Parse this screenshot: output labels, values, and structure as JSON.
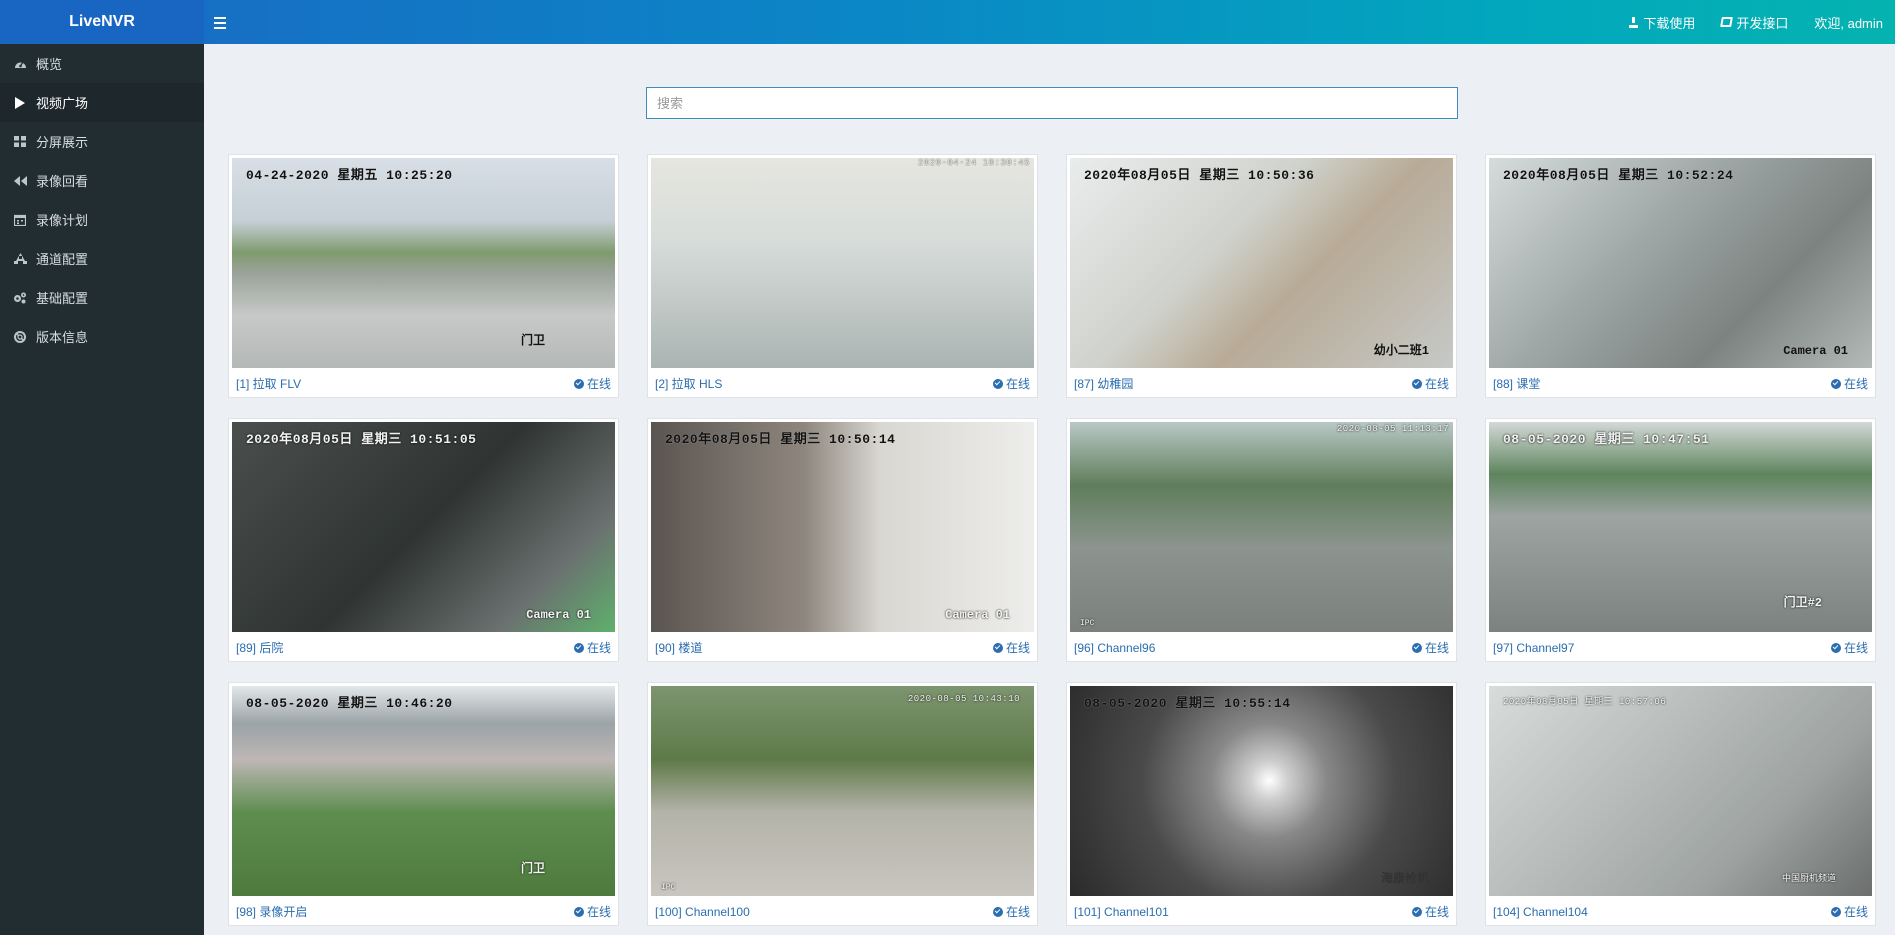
{
  "app": {
    "logo": "LiveNVR"
  },
  "topbar": {
    "download_label": "下载使用",
    "api_label": "开发接口",
    "welcome": "欢迎, admin"
  },
  "sidebar": {
    "items": [
      {
        "label": "概览",
        "icon": "dashboard-icon",
        "active": false
      },
      {
        "label": "视频广场",
        "icon": "play-icon",
        "active": true
      },
      {
        "label": "分屏展示",
        "icon": "grid-icon",
        "active": false
      },
      {
        "label": "录像回看",
        "icon": "backward-icon",
        "active": false
      },
      {
        "label": "录像计划",
        "icon": "calendar-icon",
        "active": false
      },
      {
        "label": "通道配置",
        "icon": "sitemap-icon",
        "active": false
      },
      {
        "label": "基础配置",
        "icon": "cogs-icon",
        "active": false
      },
      {
        "label": "版本信息",
        "icon": "lifebuoy-icon",
        "active": false
      }
    ]
  },
  "search": {
    "placeholder": "搜索",
    "value": ""
  },
  "channels": [
    {
      "label": "[1] 拉取 FLV",
      "status": "在线",
      "osd_time": "04-24-2020  星期五  10:25:20",
      "osd_cam": "门卫"
    },
    {
      "label": "[2] 拉取 HLS",
      "status": "在线",
      "osd_time": "2020-04-24 10:30:45",
      "osd_cam": ""
    },
    {
      "label": "[87] 幼稚园",
      "status": "在线",
      "osd_time": "2020年08月05日  星期三  10:50:36",
      "osd_cam": "幼小二班1"
    },
    {
      "label": "[88] 课堂",
      "status": "在线",
      "osd_time": "2020年08月05日  星期三  10:52:24",
      "osd_cam": "Camera 01"
    },
    {
      "label": "[89] 后院",
      "status": "在线",
      "osd_time": "2020年08月05日  星期三  10:51:05",
      "osd_cam": "Camera 01"
    },
    {
      "label": "[90] 楼道",
      "status": "在线",
      "osd_time": "2020年08月05日  星期三  10:50:14",
      "osd_cam": "Camera 01"
    },
    {
      "label": "[96] Channel96",
      "status": "在线",
      "osd_time": "2020-08-05 11:13:17",
      "osd_cam": "IPC"
    },
    {
      "label": "[97] Channel97",
      "status": "在线",
      "osd_time": "08-05-2020  星期三  10:47:51",
      "osd_cam": "门卫#2"
    },
    {
      "label": "[98] 录像开启",
      "status": "在线",
      "osd_time": "08-05-2020  星期三  10:46:20",
      "osd_cam": "门卫"
    },
    {
      "label": "[100] Channel100",
      "status": "在线",
      "osd_time": "2020-08-05 10:43:10",
      "osd_cam": "IPC"
    },
    {
      "label": "[101] Channel101",
      "status": "在线",
      "osd_time": "08-05-2020  星期三  10:55:14",
      "osd_cam": "海康枪机"
    },
    {
      "label": "[104] Channel104",
      "status": "在线",
      "osd_time": "2020年08月05日  星期三  10:57:06",
      "osd_cam": "中国厨机频道"
    }
  ]
}
